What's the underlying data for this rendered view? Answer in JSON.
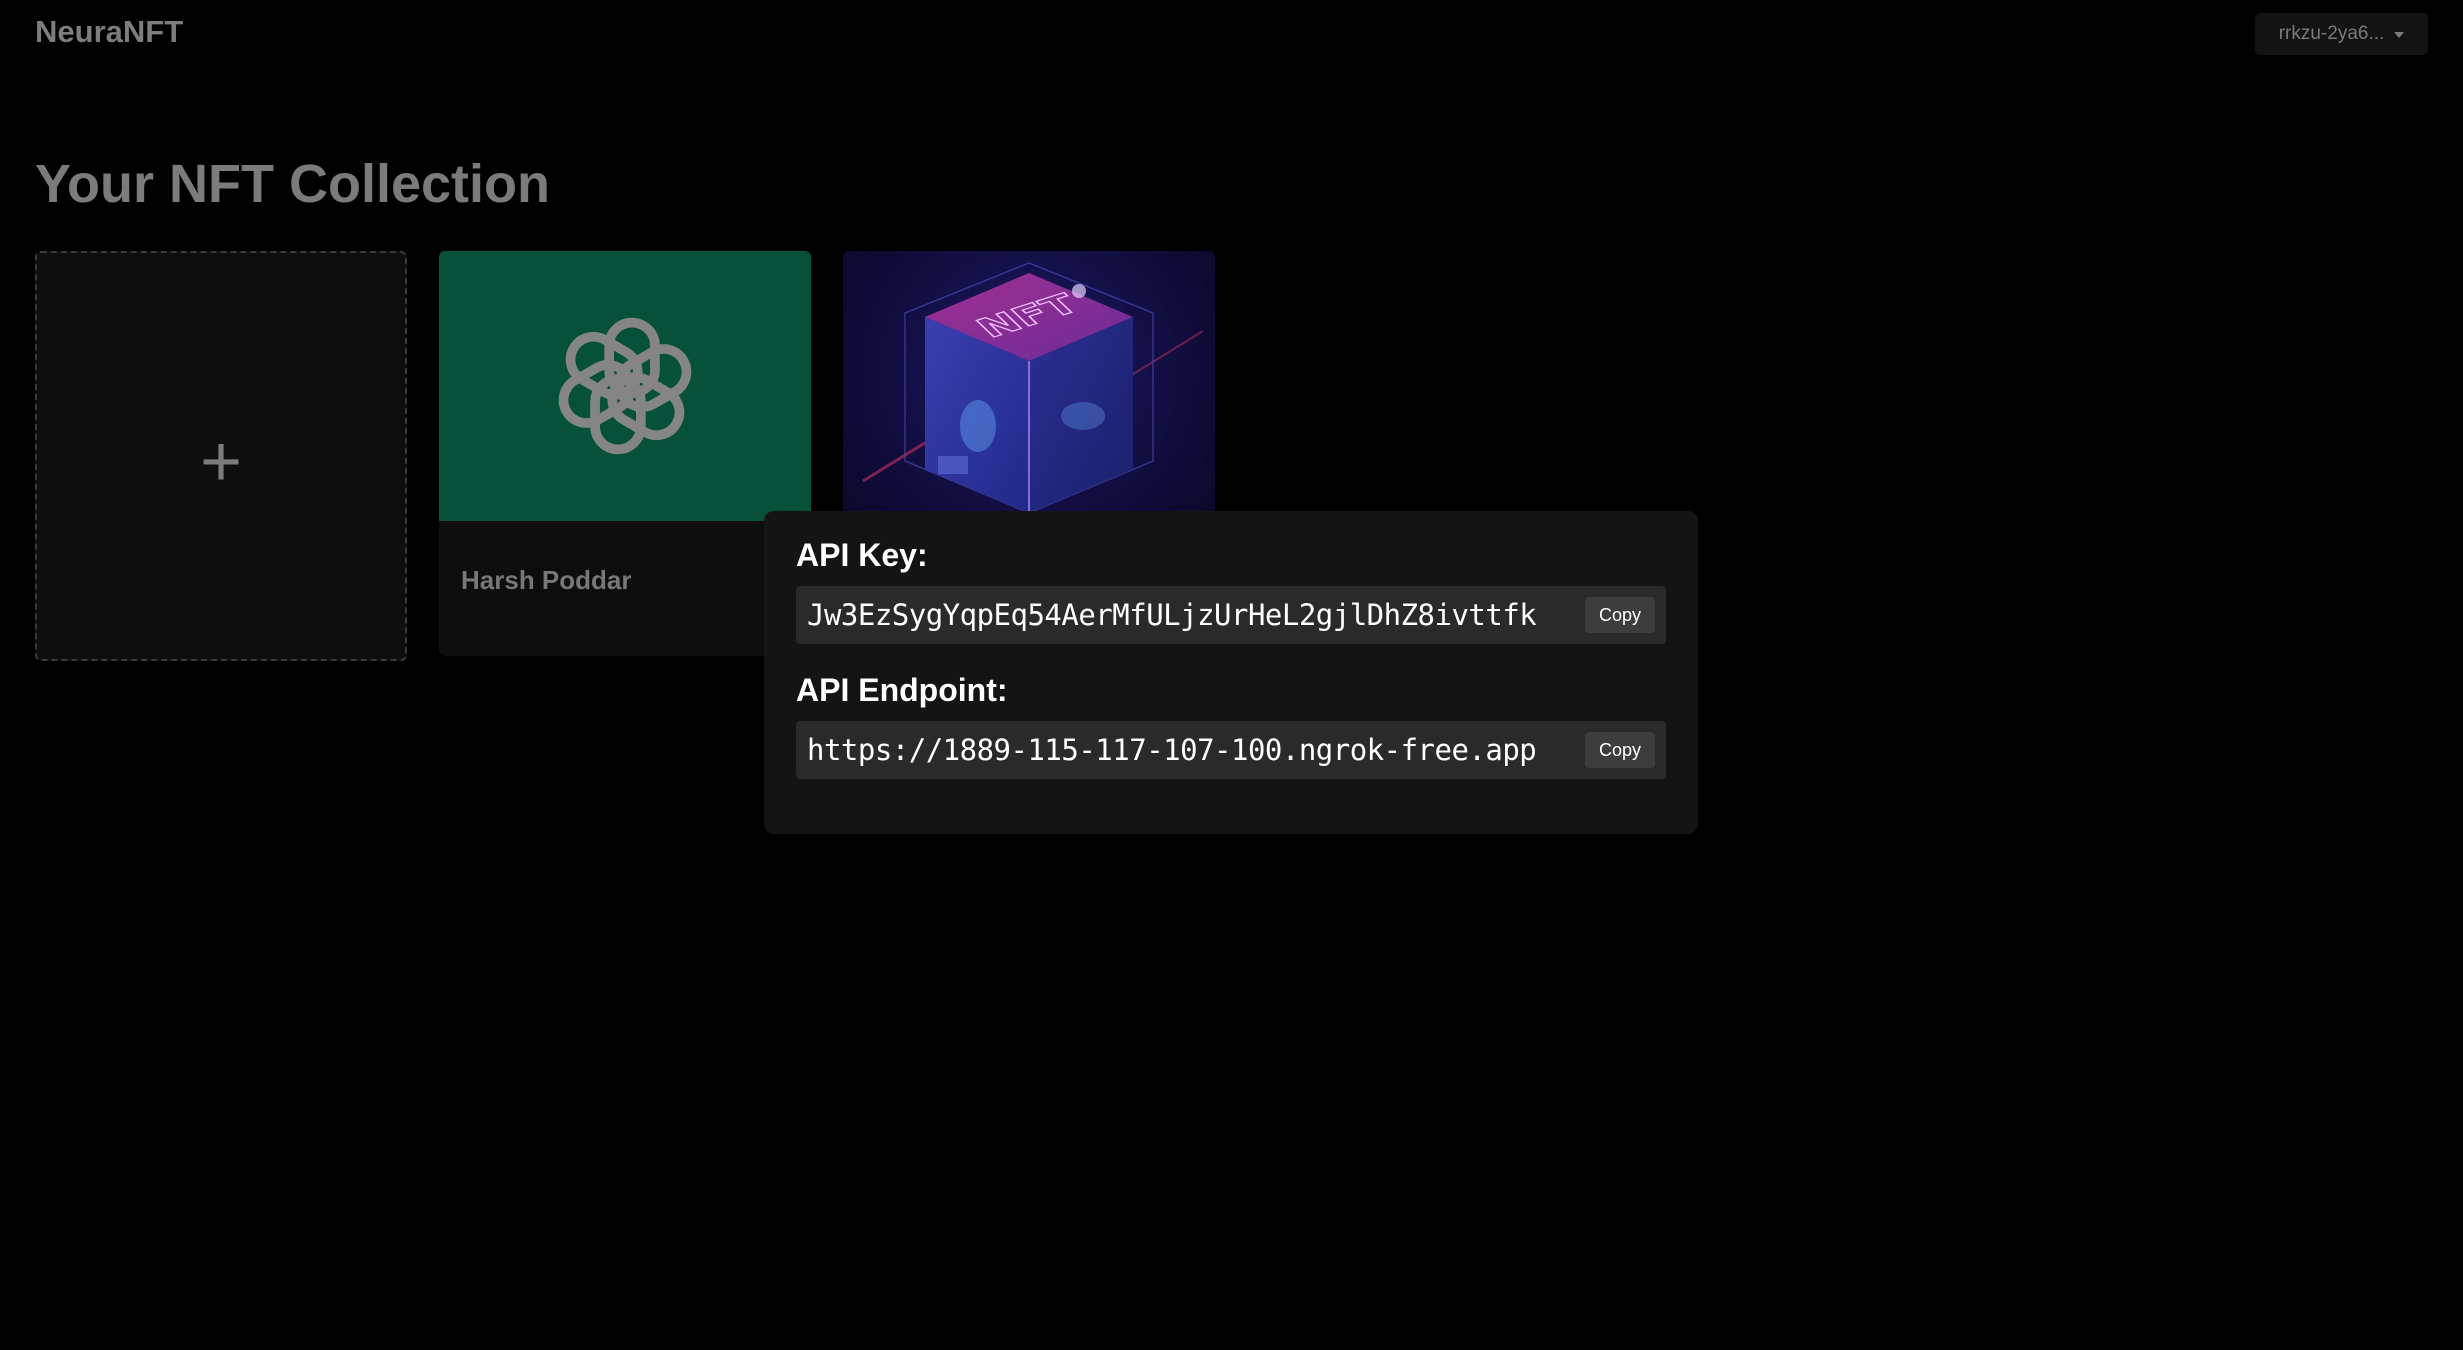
{
  "header": {
    "brand": "NeuraNFT",
    "account_label": "rrkzu-2ya6..."
  },
  "page_title": "Your NFT Collection",
  "add_card": {
    "icon": "plus-icon",
    "symbol": "+"
  },
  "nfts": [
    {
      "name": "Harsh Poddar",
      "image": "openai-logo-icon",
      "bg": "#07513a"
    },
    {
      "name": "",
      "image": "nft-cube-illustration",
      "bg": "#14104a"
    }
  ],
  "popup": {
    "api_key_label": "API Key:",
    "api_key_value": "Jw3EzSygYqpEq54AerMfULjzUrHeL2gjlDhZ8ivttfk",
    "api_endpoint_label": "API Endpoint:",
    "api_endpoint_value": "https://1889-115-117-107-100.ngrok-free.app",
    "copy_label": "Copy"
  },
  "colors": {
    "background": "#000000",
    "popup_bg": "#141414",
    "field_bg": "#2a2a2a",
    "openai_card_bg": "#07513a"
  }
}
